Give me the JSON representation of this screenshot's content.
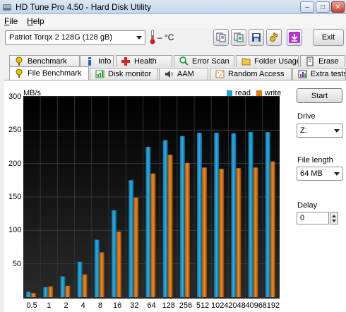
{
  "window": {
    "title": "HD Tune Pro 4.50 - Hard Disk Utility",
    "minimize_icon": "minimize-icon",
    "maximize_icon": "maximize-icon",
    "close_icon": "close-icon"
  },
  "menu": {
    "items": [
      {
        "label": "File",
        "key": "F"
      },
      {
        "label": "Help",
        "key": "H"
      }
    ]
  },
  "toolbar": {
    "drive": "Patriot Torqx 2 128G    (128 gB)",
    "temperature": "– °C",
    "icons": [
      "copy-info-icon",
      "copy-screen-icon",
      "save-icon",
      "options-icon",
      "download-icon"
    ],
    "exit_label": "Exit"
  },
  "tabs_row1": [
    {
      "label": "Benchmark",
      "icon": "benchmark-icon"
    },
    {
      "label": "Info",
      "icon": "info-icon"
    },
    {
      "label": "Health",
      "icon": "health-icon"
    },
    {
      "label": "Error Scan",
      "icon": "error-scan-icon"
    },
    {
      "label": "Folder Usage",
      "icon": "folder-icon"
    },
    {
      "label": "Erase",
      "icon": "erase-icon"
    }
  ],
  "tabs_row2": [
    {
      "label": "File Benchmark",
      "icon": "file-benchmark-icon",
      "active": true
    },
    {
      "label": "Disk monitor",
      "icon": "disk-monitor-icon"
    },
    {
      "label": "AAM",
      "icon": "speaker-icon"
    },
    {
      "label": "Random Access",
      "icon": "random-access-icon"
    },
    {
      "label": "Extra tests",
      "icon": "extra-tests-icon"
    }
  ],
  "controls": {
    "start_label": "Start",
    "drive_label": "Drive",
    "drive_value": "Z:",
    "file_length_label": "File length",
    "file_length_value": "64 MB",
    "delay_label": "Delay",
    "delay_value": "0"
  },
  "colors": {
    "read": "#1e9fd6",
    "write": "#e8780f",
    "background": "#000000"
  },
  "chart_data": {
    "type": "bar",
    "ylabel": "MB/s",
    "ylim": [
      0,
      300
    ],
    "yticks": [
      50,
      100,
      150,
      200,
      250,
      300
    ],
    "categories": [
      "0.5",
      "1",
      "2",
      "4",
      "8",
      "16",
      "32",
      "64",
      "128",
      "256",
      "512",
      "1024",
      "2048",
      "4096",
      "8192"
    ],
    "series": [
      {
        "name": "read",
        "values": [
          8,
          15,
          31,
          53,
          86,
          130,
          175,
          225,
          235,
          241,
          246,
          246,
          245,
          247,
          247
        ]
      },
      {
        "name": "write",
        "values": [
          6,
          16,
          17,
          34,
          67,
          98,
          149,
          185,
          213,
          201,
          194,
          192,
          193,
          194,
          203
        ]
      }
    ],
    "legend_position": "top-right"
  }
}
